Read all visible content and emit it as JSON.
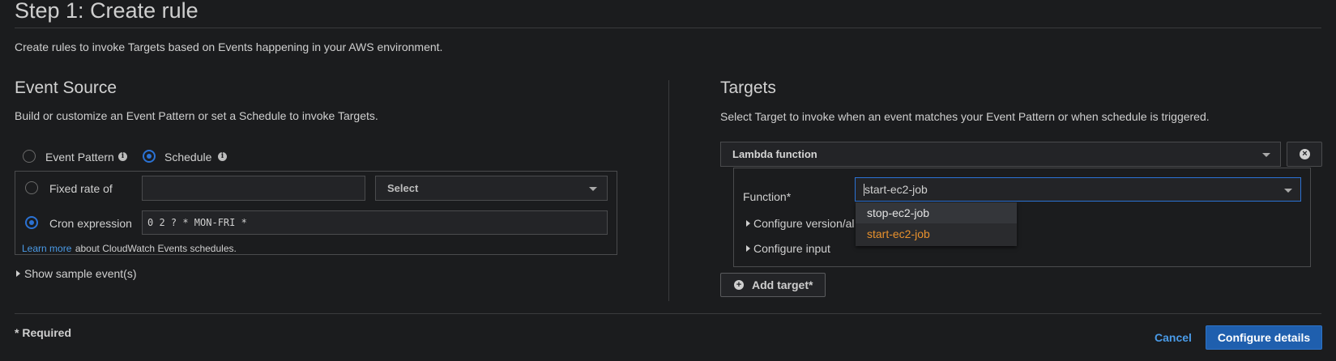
{
  "page": {
    "title": "Step 1: Create rule",
    "description": "Create rules to invoke Targets based on Events happening in your AWS environment."
  },
  "event_source": {
    "heading": "Event Source",
    "description": "Build or customize an Event Pattern or set a Schedule to invoke Targets.",
    "mode_options": [
      {
        "label": "Event Pattern",
        "selected": false
      },
      {
        "label": "Schedule",
        "selected": true
      }
    ],
    "fixed_rate": {
      "label": "Fixed rate of",
      "value": "",
      "unit_placeholder": "Select",
      "selected": false
    },
    "cron": {
      "label": "Cron expression",
      "value": "0 2 ? * MON-FRI *",
      "selected": true
    },
    "learn_more_link": "Learn more",
    "learn_more_text": "about CloudWatch Events schedules.",
    "show_sample": "Show sample event(s)"
  },
  "targets": {
    "heading": "Targets",
    "description": "Select Target to invoke when an event matches your Event Pattern or when schedule is triggered.",
    "target_type": "Lambda function",
    "function_label": "Function*",
    "function_value": "start-ec2-job",
    "function_options": [
      {
        "label": "stop-ec2-job",
        "highlighted": false
      },
      {
        "label": "start-ec2-job",
        "highlighted": true
      }
    ],
    "configure_version": "Configure version/al",
    "configure_input": "Configure input",
    "add_target": "Add target*"
  },
  "footer": {
    "required_note": "* Required",
    "cancel": "Cancel",
    "configure_details": "Configure details"
  },
  "colors": {
    "background": "#1b1c1e",
    "primary": "#1f5fae",
    "link": "#4a9be8",
    "highlight": "#e8912d"
  }
}
